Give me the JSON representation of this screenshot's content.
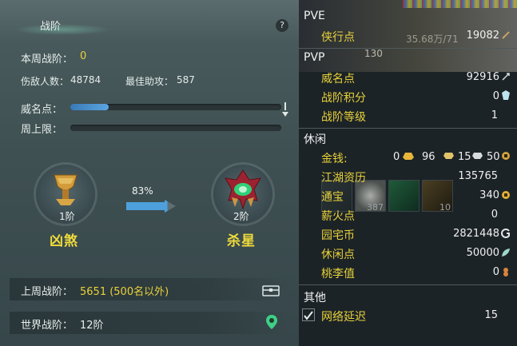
{
  "left": {
    "title": "战阶",
    "help": "?",
    "weekly_rank_label": "本周战阶：",
    "weekly_rank_value": "0",
    "kills_label": "伤敌人数：",
    "kills_value": "48784",
    "best_assist_label": "最佳助攻：",
    "best_assist_value": "587",
    "fame_label": "威名点：",
    "fame_progress": 0.18,
    "weekly_cap_label": "周上限：",
    "weekly_cap_progress": 0.0,
    "current_tier": {
      "level": "1阶",
      "name": "凶煞"
    },
    "next_tier": {
      "level": "2阶",
      "name": "杀星"
    },
    "progress_pct": "83%",
    "last_week_label": "上周战阶：",
    "last_week_value": "5651 (500名以外)",
    "world_rank_label": "世界战阶：",
    "world_rank_value": "12阶"
  },
  "right": {
    "pve": {
      "title": "PVE",
      "rows": [
        {
          "label": "侠行点",
          "value": "19082"
        }
      ]
    },
    "pvp": {
      "title": "PVP",
      "rows": [
        {
          "label": "威名点",
          "value": "92916"
        },
        {
          "label": "战阶积分",
          "value": "0"
        },
        {
          "label": "战阶等级",
          "value": "1"
        }
      ]
    },
    "leisure": {
      "title": "休闲",
      "money": {
        "label": "金钱:",
        "gold": "0",
        "silver": "96",
        "copper_a": "15",
        "copper_b": "50"
      },
      "rows": [
        {
          "label": "江湖资历",
          "value": "135765"
        },
        {
          "label": "通宝",
          "value": "340"
        },
        {
          "label": "薪火点",
          "value": "0"
        },
        {
          "label": "园宅币",
          "value": "2821448"
        },
        {
          "label": "休闲点",
          "value": "50000"
        },
        {
          "label": "桃李值",
          "value": "0"
        }
      ],
      "overlay_item_counts": [
        "387",
        "10"
      ]
    },
    "other": {
      "title": "其他",
      "rows": [
        {
          "label": "网络延迟",
          "value": "15",
          "checked": true
        }
      ]
    },
    "bg_fragments": {
      "number": "130",
      "money_text": "35.68万/71"
    }
  }
}
